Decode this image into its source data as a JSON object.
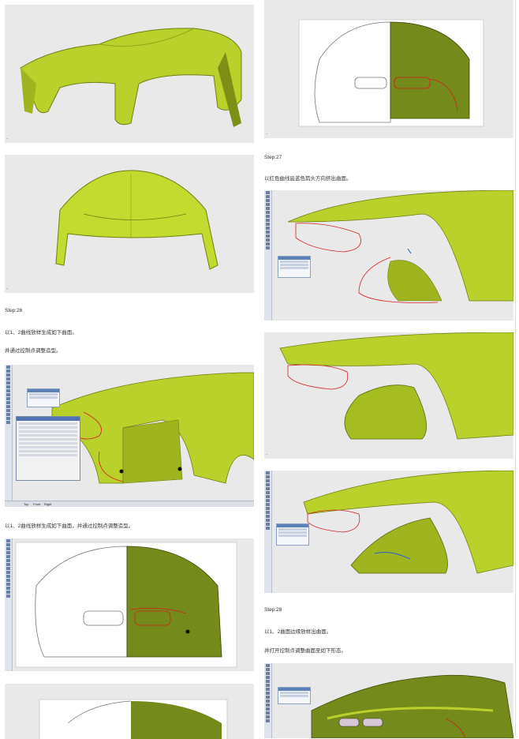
{
  "captions": {
    "step26": "Step:26",
    "step26_line1": "以1、2曲线放样生成如下曲面。",
    "step26_line2": "并通过控制点调整造型。",
    "step26_line3": "以1、2曲线放样生成如下曲面，并通过控制点调整造型。",
    "step27": "Step:27",
    "step27_line1": "以红色曲线延蓝色箭头方向挤出曲面。",
    "step28": "Step:28",
    "step28_line1": "以1、2曲面边缘放样出曲面。",
    "step28_line2": "并打开控制点调整曲面至如下形态。"
  },
  "viewport_tabs": [
    "Top",
    "Front",
    "Right"
  ],
  "colors": {
    "surface": "#b9d12a",
    "surface_dark": "#6f7f12",
    "curve_red": "#d42020",
    "panel_bg": "#e9e9e9"
  }
}
